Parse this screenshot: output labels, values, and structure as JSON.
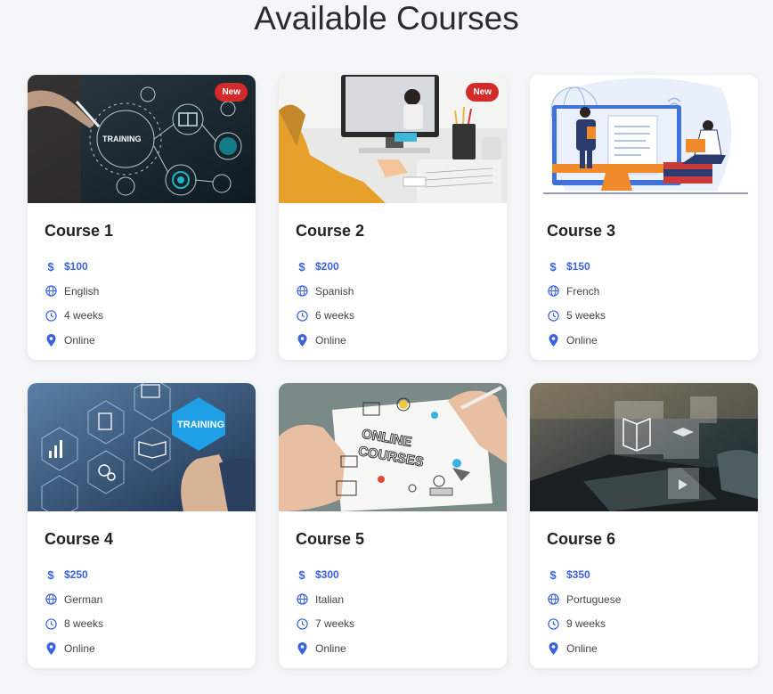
{
  "page": {
    "title": "Available Courses"
  },
  "colors": {
    "accent": "#3b62e0",
    "badge": "#d32a2a",
    "background": "#f5f6f8"
  },
  "courses": [
    {
      "title": "Course 1",
      "price": "$100",
      "language": "English",
      "duration": "4 weeks",
      "location": "Online",
      "badge": "New",
      "image_icon": "training-network-image"
    },
    {
      "title": "Course 2",
      "price": "$200",
      "language": "Spanish",
      "duration": "6 weeks",
      "location": "Online",
      "badge": "New",
      "image_icon": "video-call-study-image"
    },
    {
      "title": "Course 3",
      "price": "$150",
      "language": "French",
      "duration": "5 weeks",
      "location": "Online",
      "badge": "",
      "image_icon": "online-lesson-illustration"
    },
    {
      "title": "Course 4",
      "price": "$250",
      "language": "German",
      "duration": "8 weeks",
      "location": "Online",
      "badge": "",
      "image_icon": "training-hexagon-image"
    },
    {
      "title": "Course 5",
      "price": "$300",
      "language": "Italian",
      "duration": "7 weeks",
      "location": "Online",
      "badge": "",
      "image_icon": "online-courses-sketch-image"
    },
    {
      "title": "Course 6",
      "price": "$350",
      "language": "Portuguese",
      "duration": "9 weeks",
      "location": "Online",
      "badge": "",
      "image_icon": "laptop-elearning-image"
    }
  ],
  "image_text": {
    "c1": "TRAINING",
    "c4": "TRAINING",
    "c5_line1": "ONLINE",
    "c5_line2": "COURSES"
  }
}
